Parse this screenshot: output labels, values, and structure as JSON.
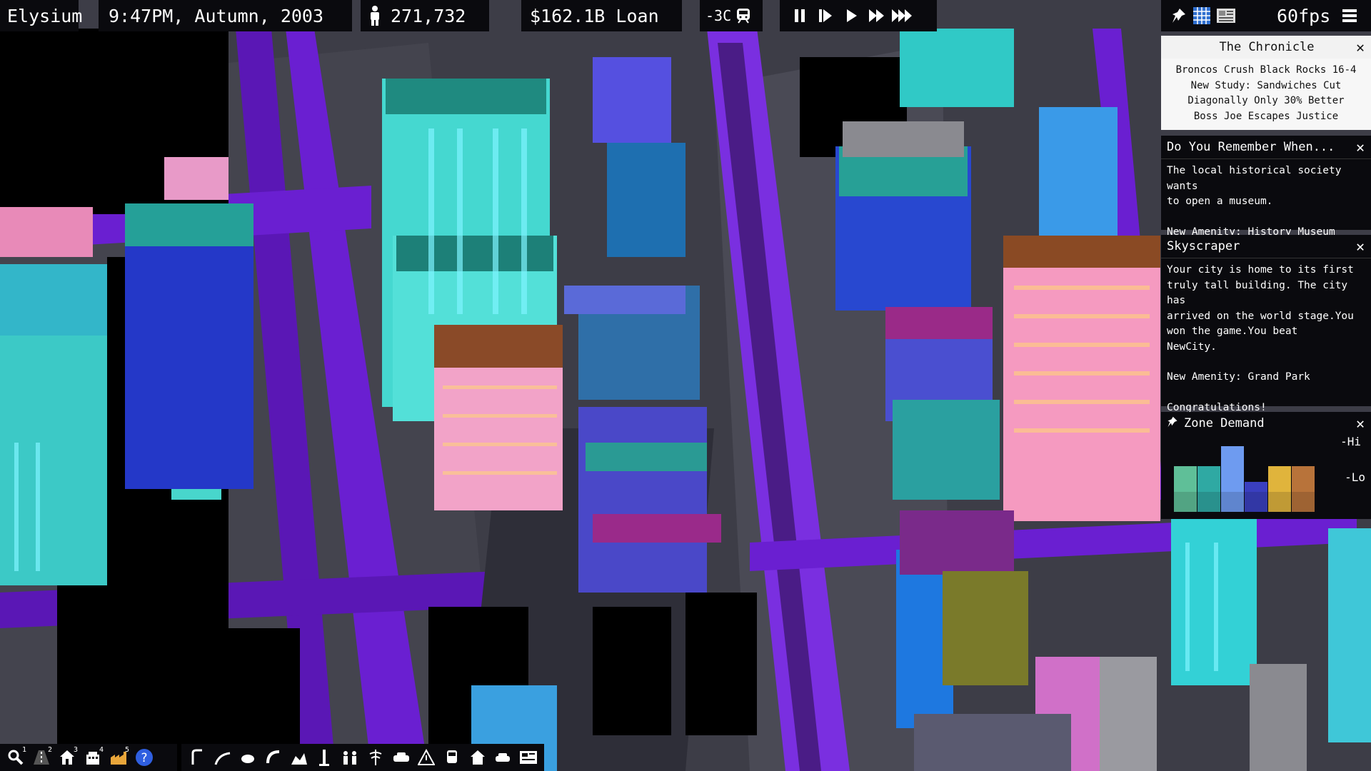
{
  "topbar": {
    "city_name": "Elysium",
    "datetime": "9:47PM, Autumn, 2003",
    "population": "271,732",
    "money": "$162.1B Loan",
    "temperature": "-3C",
    "fps": "60fps"
  },
  "panels": {
    "chronicle": {
      "title": "The Chronicle",
      "headlines": [
        "Broncos Crush Black Rocks 16-4",
        "New Study: Sandwiches Cut",
        "Diagonally Only 30% Better",
        "Boss Joe Escapes Justice"
      ]
    },
    "remember": {
      "title": "Do You Remember When...",
      "line1": "The local historical society wants",
      "line2": "to open a museum.",
      "amenity": "New Amenity: History Museum"
    },
    "skyscraper": {
      "title": "Skyscraper",
      "lines": [
        "Your city is home to its first",
        "truly tall building. The city has",
        "arrived on the world stage.You",
        "won the game.You beat",
        "NewCity."
      ],
      "amenity": "New Amenity: Grand Park",
      "congrats": "Congratulations!"
    },
    "zone_demand": {
      "title": "Zone Demand",
      "hi_label": "-Hi",
      "lo_label": "-Lo",
      "bars": [
        {
          "zone": "residential-low",
          "color": "#5fbf98",
          "level": 0.52
        },
        {
          "zone": "residential-high",
          "color": "#2fa9a3",
          "level": 0.52
        },
        {
          "zone": "commercial-high",
          "color": "#6e9bf0",
          "level": 0.92
        },
        {
          "zone": "commercial-low",
          "color": "#3a3fc0",
          "level": 0.2
        },
        {
          "zone": "industrial-low",
          "color": "#e0b43c",
          "level": 0.52
        },
        {
          "zone": "industrial-high",
          "color": "#b8733a",
          "level": 0.52
        }
      ]
    }
  },
  "toolbar": {
    "tools": [
      {
        "name": "query-tool",
        "num": "1"
      },
      {
        "name": "road-tool",
        "num": "2"
      },
      {
        "name": "residential-zone-tool",
        "num": "3"
      },
      {
        "name": "commercial-zone-tool",
        "num": "4"
      },
      {
        "name": "industrial-zone-tool",
        "num": "5"
      },
      {
        "name": "help-tool",
        "num": ""
      }
    ],
    "tools2": [
      "transit",
      "rail",
      "tunnel",
      "pipe",
      "heritage",
      "monument",
      "people",
      "medical",
      "vehicle",
      "hazard",
      "bus",
      "house",
      "car",
      "newspaper"
    ]
  },
  "colors": {
    "bar_bg": "#0a0a0e",
    "road": "#6a1fd1",
    "ground": "#3d3d47"
  }
}
